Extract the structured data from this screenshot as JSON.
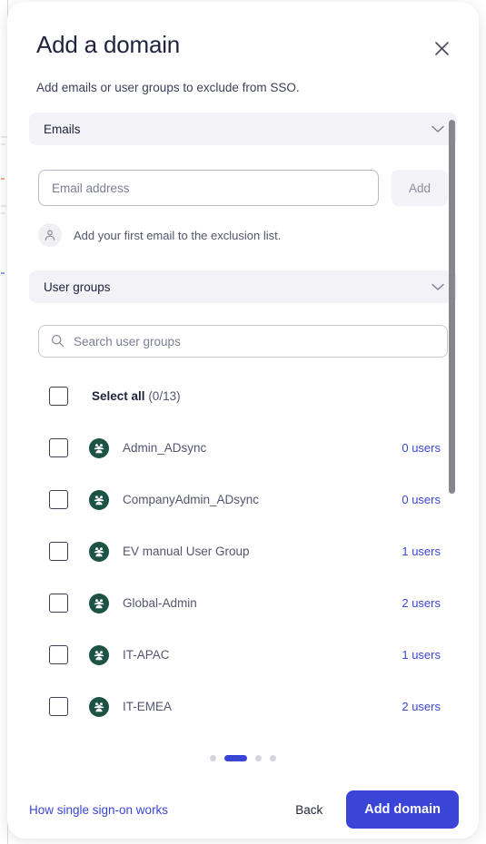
{
  "background": {
    "accent_orange": "#f0b089",
    "accent_blue": "#8aa0ea"
  },
  "modal": {
    "title": "Add a domain",
    "subtitle": "Add emails or user groups to exclude from SSO.",
    "close_icon": "close-icon",
    "accent_color": "#3a45d8",
    "group_icon_color": "#1c5345"
  },
  "emails_section": {
    "header_label": "Emails",
    "chevron_icon": "chevron-down-icon",
    "expanded": true,
    "input": {
      "placeholder": "Email address",
      "value": ""
    },
    "add_button": {
      "label": "Add",
      "disabled": true
    },
    "empty_hint": {
      "icon": "person-icon",
      "text": "Add your first email to the exclusion list."
    }
  },
  "user_groups_section": {
    "header_label": "User groups",
    "chevron_icon": "chevron-down-icon",
    "expanded": true,
    "search": {
      "icon": "search-icon",
      "placeholder": "Search user groups",
      "value": ""
    },
    "select_all": {
      "label": "Select all",
      "count": "(0/13)",
      "checked": false
    },
    "rows": [
      {
        "name": "Admin_ADsync",
        "users": "0 users",
        "checked": false,
        "icon": "user-group-icon"
      },
      {
        "name": "CompanyAdmin_ADsync",
        "users": "0 users",
        "checked": false,
        "icon": "user-group-icon"
      },
      {
        "name": "EV manual User Group",
        "users": "1 users",
        "checked": false,
        "icon": "user-group-icon"
      },
      {
        "name": "Global-Admin",
        "users": "2 users",
        "checked": false,
        "icon": "user-group-icon"
      },
      {
        "name": "IT-APAC",
        "users": "1 users",
        "checked": false,
        "icon": "user-group-icon"
      },
      {
        "name": "IT-EMEA",
        "users": "2 users",
        "checked": false,
        "icon": "user-group-icon"
      }
    ]
  },
  "pagination": {
    "total": 4,
    "active_index": 1
  },
  "footer": {
    "help_link": "How single sign-on works",
    "back_label": "Back",
    "submit_label": "Add domain"
  }
}
